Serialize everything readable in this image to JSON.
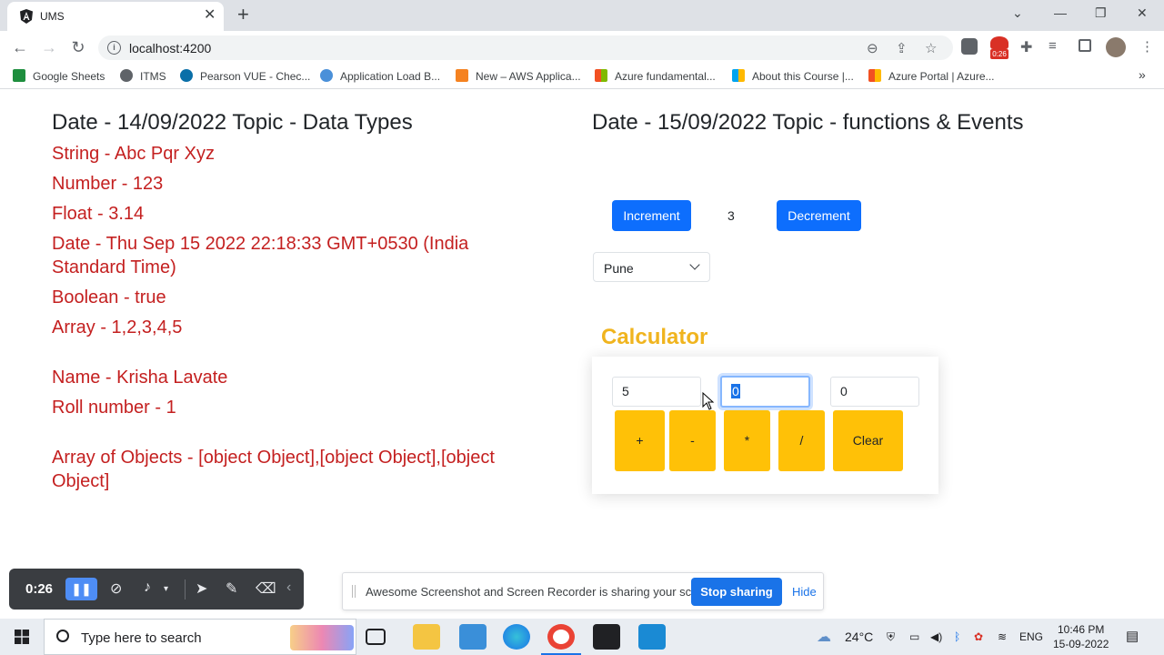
{
  "browser": {
    "tab_title": "UMS",
    "url": "localhost:4200",
    "ext_timer": "0:26",
    "bookmarks": [
      {
        "label": "Google Sheets",
        "color": "#1e8e3e"
      },
      {
        "label": "ITMS",
        "color": "#5f6368"
      },
      {
        "label": "Pearson VUE - Chec...",
        "color": "#0a6fa8"
      },
      {
        "label": "Application Load B...",
        "color": "#4a90d9"
      },
      {
        "label": "New – AWS Applica...",
        "color": "#f58220"
      },
      {
        "label": "Azure fundamental...",
        "color": "#f25022"
      },
      {
        "label": "About this Course |...",
        "color": "#7fba00"
      },
      {
        "label": "Azure Portal | Azure...",
        "color": "#ffb900"
      }
    ]
  },
  "left": {
    "heading": "Date - 14/09/2022 Topic - Data Types",
    "string": "String - Abc Pqr Xyz",
    "number": "Number - 123",
    "float": "Float - 3.14",
    "date_line1": "Date - Thu Sep 15 2022 22:18:33 GMT+0530 (India",
    "date_line2": "Standard Time)",
    "boolean": "Boolean - true",
    "array": "Array - 1,2,3,4,5",
    "name": "Name - Krisha Lavate",
    "roll": "Roll number - 1",
    "objects_line1": "Array of Objects - [object Object],[object Object],[object",
    "objects_line2": "Object]"
  },
  "right": {
    "heading": "Date - 15/09/2022 Topic - functions & Events",
    "increment_label": "Increment",
    "counter_value": "3",
    "decrement_label": "Decrement",
    "city_selected": "Pune"
  },
  "calculator": {
    "title": "Calculator",
    "input1": "5",
    "input2": "0",
    "result": "0",
    "buttons": {
      "add": "+",
      "sub": "-",
      "mul": "*",
      "div": "/",
      "clear": "Clear"
    }
  },
  "recorder": {
    "time": "0:26",
    "share_message": "Awesome Screenshot and Screen Recorder is sharing your screen.",
    "stop_label": "Stop sharing",
    "hide_label": "Hide"
  },
  "taskbar": {
    "search_placeholder": "Type here to search",
    "temperature": "24°C",
    "language": "ENG",
    "time": "10:46 PM",
    "date": "15-09-2022"
  }
}
